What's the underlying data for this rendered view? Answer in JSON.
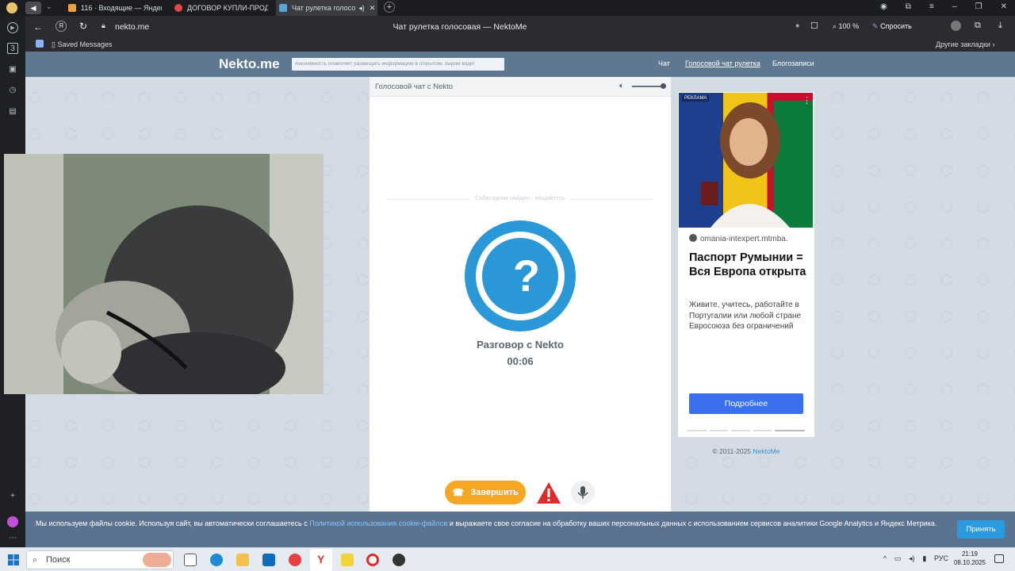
{
  "tabs": [
    {
      "label": "116 · Входящие — Яндек",
      "color": "#e8a33d"
    },
    {
      "label": "ДОГОВОР КУПЛИ-ПРОД",
      "color": "#e04848"
    },
    {
      "label": "Чат рулетка голосо",
      "color": "#5aa3d6"
    }
  ],
  "address": {
    "url": "nekto.me",
    "page_title": "Чат рулетка голосовая — NektoMe",
    "zoom": "100 %",
    "ask_label": "Спросить"
  },
  "bookmarks": {
    "saved": "Saved Messages",
    "other": "Другие закладки"
  },
  "sidebar": {
    "badge": "3"
  },
  "site": {
    "logo": "Nekto.me",
    "tagline": "Анонимность позволяет размещать информацию в открытом, сыром виде!",
    "nav": [
      "Чат",
      "Голосовой чат рулетка",
      "Блогозаписи"
    ]
  },
  "chat": {
    "header": "Голосовой чат с Nekto",
    "status": "Собеседник найден - общайтесь",
    "avatar_symbol": "?",
    "title": "Разговор с Nekto",
    "timer": "00:06",
    "end_label": "Завершить"
  },
  "ad": {
    "badge": "РЕКЛАМА",
    "domain": "omania-intexpert.mtmba.",
    "headline": "Паспорт Румынии = Вся Европа открыта",
    "body": "Живите, учитесь, работайте в Португалии или любой стране Евросоюза без ограничений",
    "button": "Подробнее"
  },
  "footer": {
    "copyright": "© 2011-2025",
    "link": "NektoMe"
  },
  "cookie": {
    "text_before": "Мы используем файлы cookie. Используя сайт, вы автоматически соглашаетесь с ",
    "link": "Политикой использования cookie-файлов",
    "text_after": " и выражаете свое согласие на обработку ваших персональных данных с использованием сервисов аналитики Google Analytics и Яндекс Метрика.",
    "accept": "Принять"
  },
  "taskbar": {
    "search": "Поиск",
    "lang": "РУС",
    "time": "21:19",
    "date": "08.10.2025"
  }
}
